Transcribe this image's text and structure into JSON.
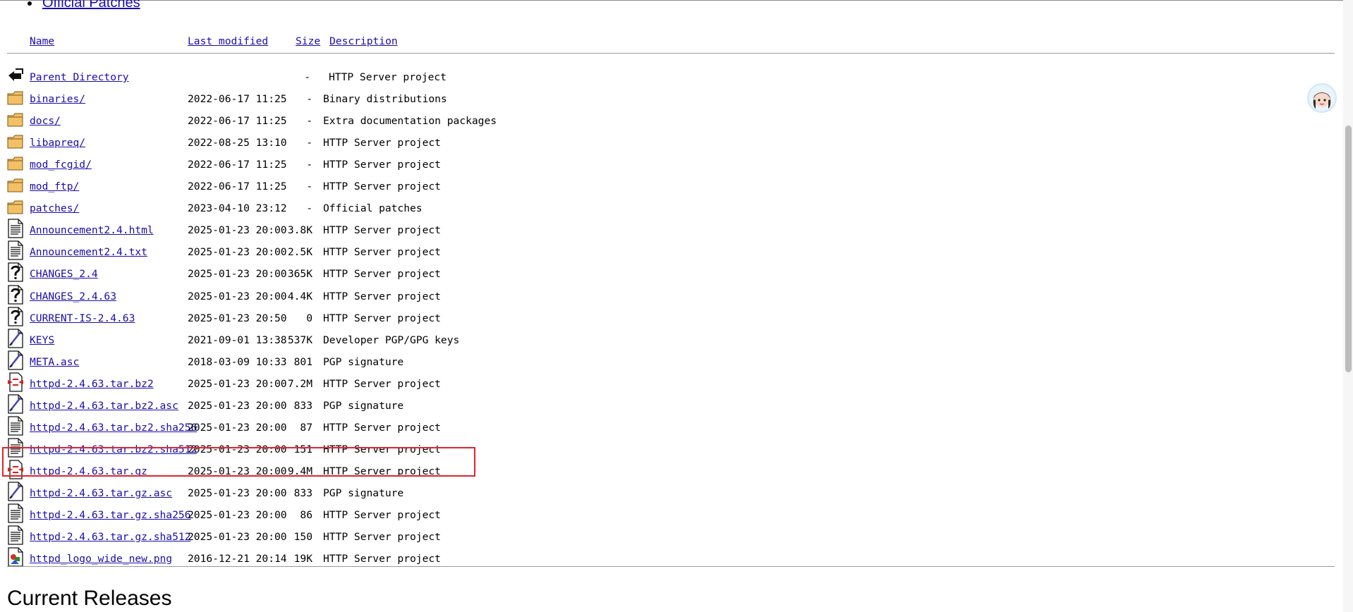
{
  "top_link": {
    "label": "Official Patches"
  },
  "columns": {
    "name": "Name",
    "last_modified": "Last modified",
    "size": "Size",
    "description": "Description"
  },
  "entries": [
    {
      "icon": "back-icon",
      "name": "Parent Directory",
      "date": "",
      "size": "-",
      "description": "HTTP Server project"
    },
    {
      "icon": "folder-icon",
      "name": "binaries/",
      "date": "2022-06-17 11:25",
      "size": "-",
      "description": "Binary distributions"
    },
    {
      "icon": "folder-icon",
      "name": "docs/",
      "date": "2022-06-17 11:25",
      "size": "-",
      "description": "Extra documentation packages"
    },
    {
      "icon": "folder-icon",
      "name": "libapreq/",
      "date": "2022-08-25 13:10",
      "size": "-",
      "description": "HTTP Server project"
    },
    {
      "icon": "folder-icon",
      "name": "mod_fcgid/",
      "date": "2022-06-17 11:25",
      "size": "-",
      "description": "HTTP Server project"
    },
    {
      "icon": "folder-icon",
      "name": "mod_ftp/",
      "date": "2022-06-17 11:25",
      "size": "-",
      "description": "HTTP Server project"
    },
    {
      "icon": "folder-icon",
      "name": "patches/",
      "date": "2023-04-10 23:12",
      "size": "-",
      "description": "Official patches"
    },
    {
      "icon": "text-file-icon",
      "name": "Announcement2.4.html",
      "date": "2025-01-23 20:00",
      "size": "3.8K",
      "description": "HTTP Server project"
    },
    {
      "icon": "text-file-icon",
      "name": "Announcement2.4.txt",
      "date": "2025-01-23 20:00",
      "size": "2.5K",
      "description": "HTTP Server project"
    },
    {
      "icon": "unknown-file-icon",
      "name": "CHANGES_2.4",
      "date": "2025-01-23 20:00",
      "size": "365K",
      "description": "HTTP Server project"
    },
    {
      "icon": "unknown-file-icon",
      "name": "CHANGES_2.4.63",
      "date": "2025-01-23 20:00",
      "size": "4.4K",
      "description": "HTTP Server project"
    },
    {
      "icon": "unknown-file-icon",
      "name": "CURRENT-IS-2.4.63",
      "date": "2025-01-23 20:50",
      "size": "0",
      "description": "HTTP Server project"
    },
    {
      "icon": "signature-file-icon",
      "name": "KEYS",
      "date": "2021-09-01 13:38",
      "size": "537K",
      "description": "Developer PGP/GPG keys"
    },
    {
      "icon": "signature-file-icon",
      "name": "META.asc",
      "date": "2018-03-09 10:33",
      "size": "801",
      "description": "PGP signature"
    },
    {
      "icon": "compressed-file-icon",
      "name": "httpd-2.4.63.tar.bz2",
      "date": "2025-01-23 20:00",
      "size": "7.2M",
      "description": "HTTP Server project"
    },
    {
      "icon": "signature-file-icon",
      "name": "httpd-2.4.63.tar.bz2.asc",
      "date": "2025-01-23 20:00",
      "size": "833",
      "description": "PGP signature"
    },
    {
      "icon": "text-file-icon",
      "name": "httpd-2.4.63.tar.bz2.sha256",
      "date": "2025-01-23 20:00",
      "size": "87",
      "description": "HTTP Server project"
    },
    {
      "icon": "text-file-icon",
      "name": "httpd-2.4.63.tar.bz2.sha512",
      "date": "2025-01-23 20:00",
      "size": "151",
      "description": "HTTP Server project"
    },
    {
      "icon": "compressed-file-icon",
      "name": "httpd-2.4.63.tar.gz",
      "date": "2025-01-23 20:00",
      "size": "9.4M",
      "description": "HTTP Server project"
    },
    {
      "icon": "signature-file-icon",
      "name": "httpd-2.4.63.tar.gz.asc",
      "date": "2025-01-23 20:00",
      "size": "833",
      "description": "PGP signature"
    },
    {
      "icon": "text-file-icon",
      "name": "httpd-2.4.63.tar.gz.sha256",
      "date": "2025-01-23 20:00",
      "size": "86",
      "description": "HTTP Server project"
    },
    {
      "icon": "text-file-icon",
      "name": "httpd-2.4.63.tar.gz.sha512",
      "date": "2025-01-23 20:00",
      "size": "150",
      "description": "HTTP Server project"
    },
    {
      "icon": "image-file-icon",
      "name": "httpd_logo_wide_new.png",
      "date": "2016-12-21 20:14",
      "size": "19K",
      "description": "HTTP Server project"
    }
  ],
  "section_heading": "Current Releases",
  "colors": {
    "link": "#1a0dab",
    "highlight": "#e2232a"
  }
}
